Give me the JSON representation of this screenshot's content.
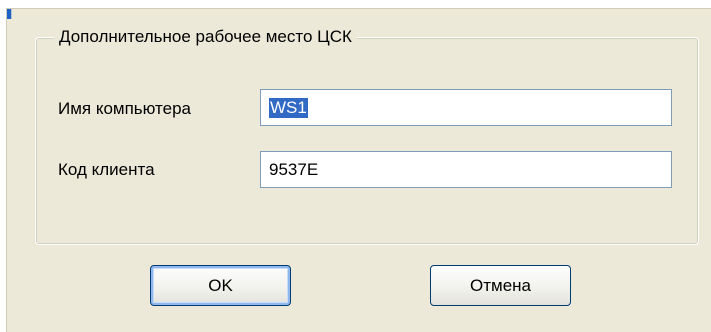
{
  "dialog": {
    "group_title": "Дополнительное рабочее место ЦСК",
    "fields": {
      "computer_name": {
        "label": "Имя компьютера",
        "value": "WS1",
        "selected": true
      },
      "client_code": {
        "label": "Код клиента",
        "value": "9537E"
      }
    },
    "buttons": {
      "ok_label": "OK",
      "cancel_label": "Отмена"
    }
  },
  "colors": {
    "dialog_bg": "#ece9d8",
    "selection_bg": "#316ac5",
    "button_border": "#003c74",
    "input_border": "#7f9db9"
  }
}
